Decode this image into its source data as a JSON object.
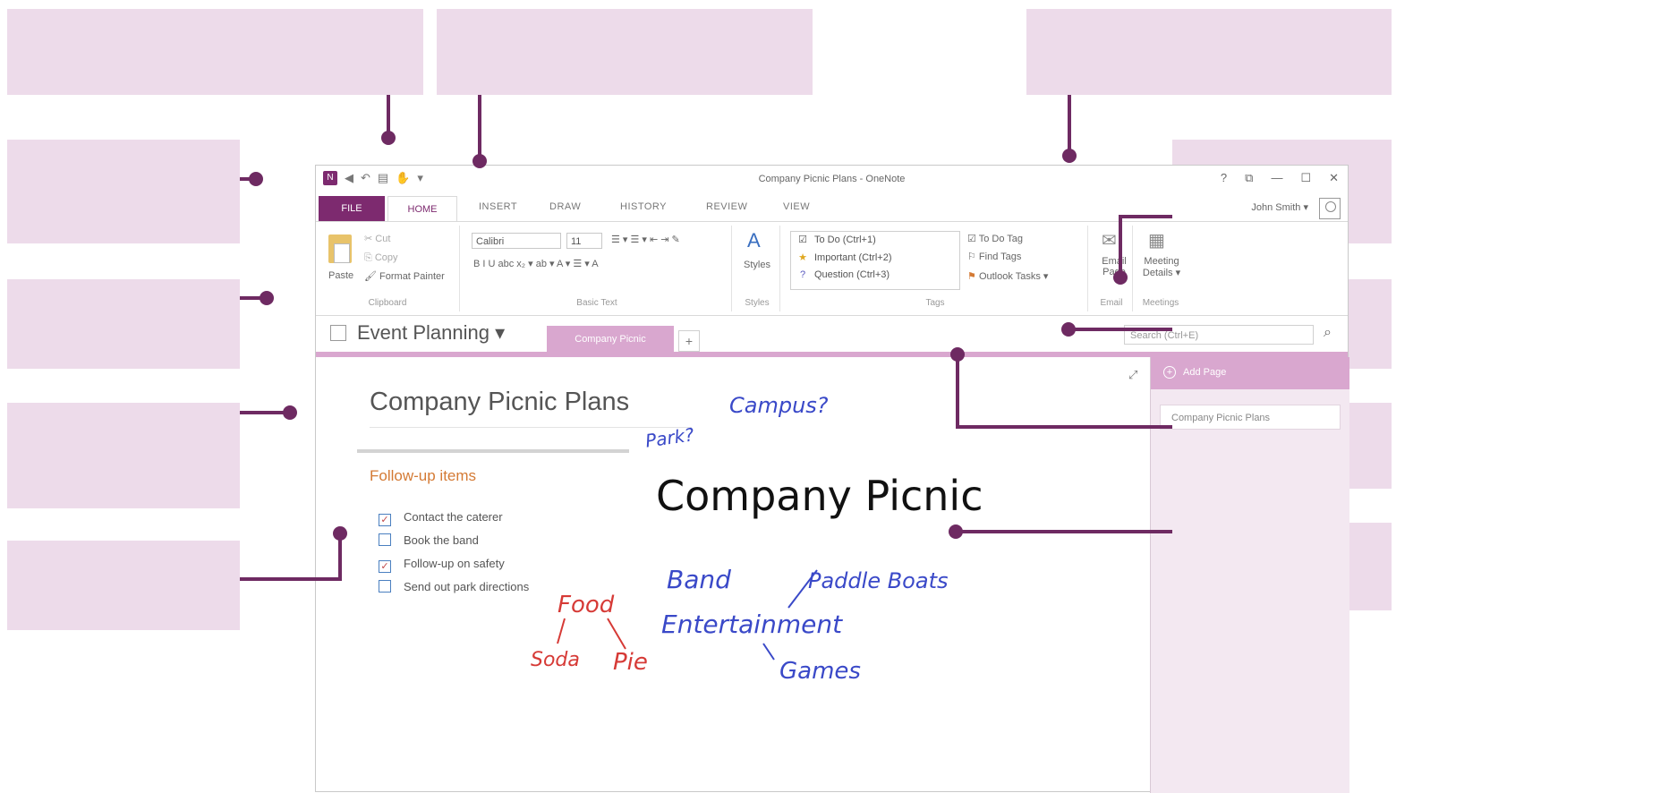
{
  "window": {
    "title": "Company Picnic Plans - OneNote",
    "app_icon": "onenote-icon",
    "controls": [
      "?",
      "⧉",
      "—",
      "☐",
      "✕"
    ]
  },
  "quick_access": {
    "back": "◀",
    "undo": "↶",
    "dock": "▤",
    "touch": "✋",
    "more": "▾"
  },
  "ribbon_tabs": [
    "FILE",
    "HOME",
    "INSERT",
    "DRAW",
    "HISTORY",
    "REVIEW",
    "VIEW"
  ],
  "user": {
    "name": "John Smith ▾"
  },
  "ribbon": {
    "clipboard": {
      "paste": "Paste",
      "cut": "Cut",
      "copy": "Copy",
      "format_painter": "Format Painter",
      "label": "Clipboard"
    },
    "basic_text": {
      "font": "Calibri",
      "size": "11",
      "label": "Basic Text",
      "row1_glyphs": "☰ ▾  ☰ ▾  ⇤  ⇥   ✎",
      "row2_glyphs": "B  I  U  abc  x₂ ▾   ab ▾  A ▾   ☰ ▾  A"
    },
    "styles": {
      "button": "Styles",
      "label": "Styles"
    },
    "tags": {
      "items": [
        {
          "icon": "☑",
          "label": "To Do (Ctrl+1)"
        },
        {
          "icon": "★",
          "label": "Important (Ctrl+2)"
        },
        {
          "icon": "?",
          "label": "Question (Ctrl+3)"
        }
      ],
      "todo_tag": "To Do Tag",
      "find_tags": "Find Tags",
      "outlook_tasks": "Outlook Tasks ▾",
      "label": "Tags"
    },
    "email": {
      "button": "Email Page",
      "label": "Email"
    },
    "meetings": {
      "button": "Meeting Details ▾",
      "label": "Meetings"
    }
  },
  "notebook": {
    "name": "Event Planning ▾",
    "section_tab": "Company Picnic",
    "add_tab": "+"
  },
  "search": {
    "placeholder": "Search (Ctrl+E)"
  },
  "page": {
    "title": "Company Picnic Plans",
    "heading": "Follow-up items",
    "todos": [
      {
        "checked": true,
        "text": "Contact the caterer"
      },
      {
        "checked": false,
        "text": "Book the band"
      },
      {
        "checked": true,
        "text": "Follow-up on safety"
      },
      {
        "checked": false,
        "text": "Send out park directions"
      }
    ]
  },
  "handwriting": {
    "park": "Park?",
    "campus": "Campus?",
    "main": "Company Picnic",
    "band": "Band",
    "paddle_boats": "Paddle Boats",
    "entertainment": "Entertainment",
    "games": "Games",
    "food": "Food",
    "soda": "Soda",
    "pie": "Pie"
  },
  "pages_pane": {
    "add_page": "Add Page",
    "items": [
      "Company Picnic Plans"
    ]
  },
  "colors": {
    "accent": "#7d2a6f",
    "accent_light": "#d9a7cf",
    "callout_bg": "#eddbea",
    "ink_blue": "#3a49c8",
    "ink_red": "#d63a36"
  }
}
